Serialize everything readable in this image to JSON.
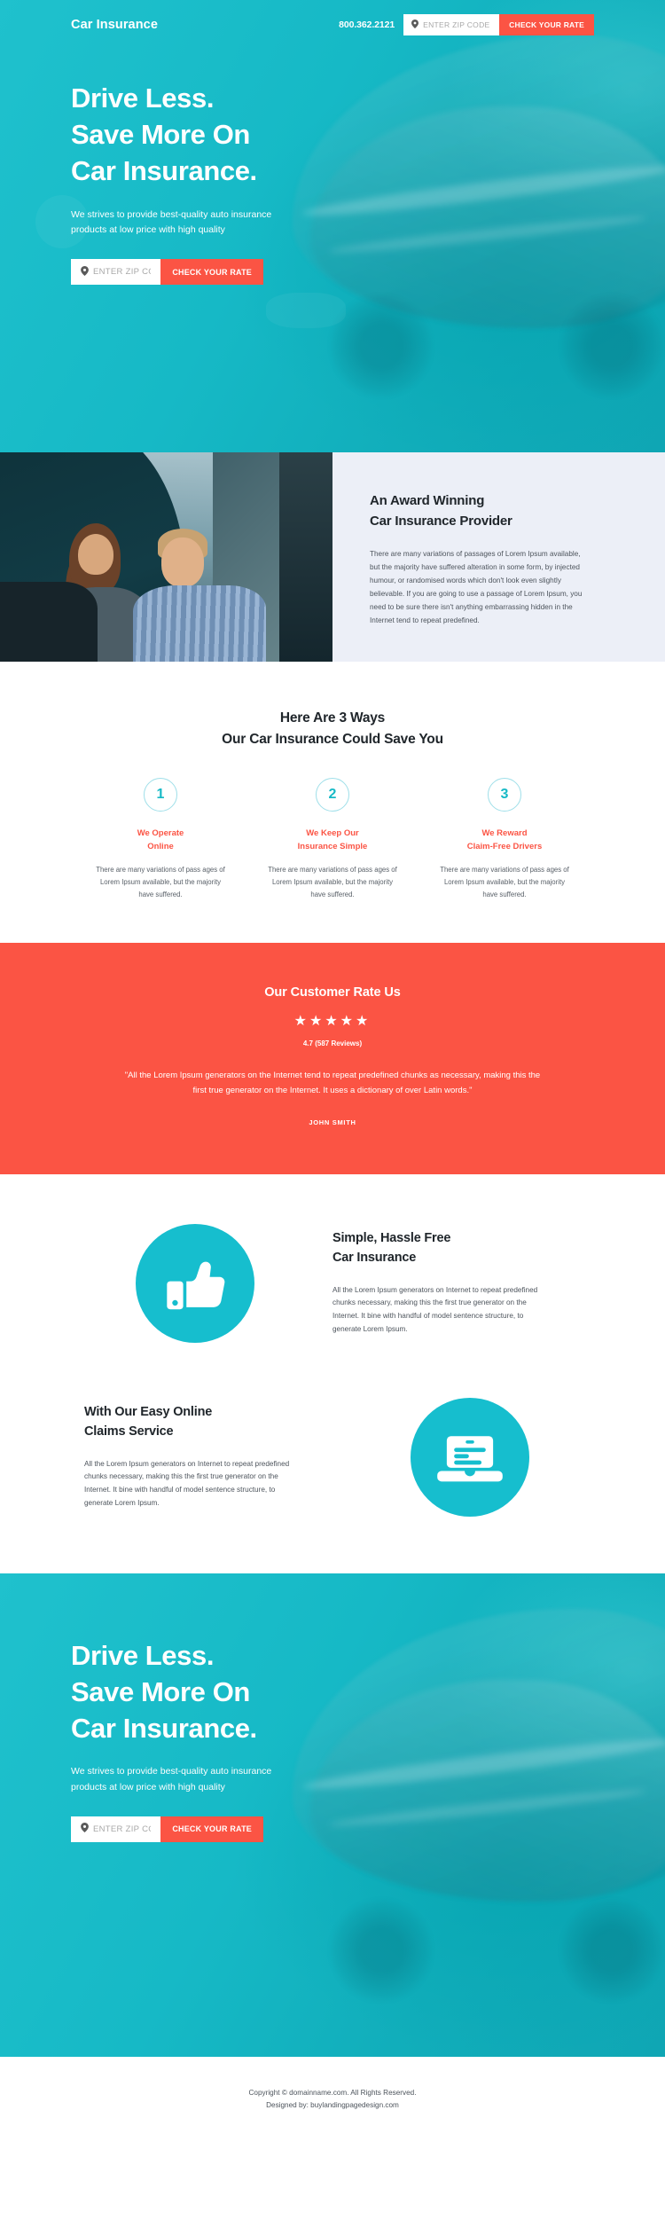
{
  "header": {
    "brand": "Car Insurance",
    "phone": "800.362.2121",
    "zip_placeholder": "ENTER ZIP CODE",
    "zip_value": "",
    "cta_label": "CHECK YOUR RATE",
    "pin_icon": "location-pin-icon"
  },
  "hero": {
    "title_line1": "Drive Less.",
    "title_line2": "Save More On",
    "title_line3": "Car Insurance.",
    "subtitle_line1": "We strives to provide best-quality auto insurance",
    "subtitle_line2": "products at low price with high quality",
    "zip_placeholder": "ENTER ZIP CODE",
    "zip_value": "",
    "cta_label": "CHECK YOUR RATE"
  },
  "award": {
    "title_line1": "An Award Winning",
    "title_line2": "Car Insurance Provider",
    "body": "There are many variations of passages of Lorem Ipsum available, but the majority have suffered alteration in some form, by injected humour, or randomised words which don't look even slightly believable. If you are going to use a passage of Lorem Ipsum, you need to be sure there isn't anything embarrassing hidden in the Internet tend to repeat predefined."
  },
  "ways": {
    "title_line1": "Here Are 3 Ways",
    "title_line2": "Our Car Insurance Could Save You",
    "items": [
      {
        "number": "1",
        "head_line1": "We Operate",
        "head_line2": "Online",
        "body": "There are many variations of pass ages of Lorem Ipsum available, but the majority have suffered."
      },
      {
        "number": "2",
        "head_line1": "We Keep Our",
        "head_line2": "Insurance Simple",
        "body": "There are many variations of pass ages of Lorem Ipsum available, but the majority have suffered."
      },
      {
        "number": "3",
        "head_line1": "We Reward",
        "head_line2": "Claim-Free Drivers",
        "body": "There are many variations of pass ages of Lorem Ipsum available, but the majority have suffered."
      }
    ]
  },
  "testimonial": {
    "title": "Our Customer Rate Us",
    "stars": "★★★★★",
    "star_count": 5,
    "score": "4.7 (587 Reviews)",
    "quote": "\"All the Lorem Ipsum generators on the Internet tend to repeat predefined chunks as necessary, making this the first true generator on the Internet. It uses a dictionary of over Latin words.\"",
    "author": "JOHN SMITH"
  },
  "features": [
    {
      "icon": "thumbs-up-icon",
      "title_line1": "Simple, Hassle Free",
      "title_line2": "Car Insurance",
      "body": "All the Lorem Ipsum generators on Internet to repeat predefined chunks necessary, making this the first true generator on the Internet. It bine with handful of model sentence structure, to generate Lorem Ipsum."
    },
    {
      "icon": "laptop-document-icon",
      "title_line1": "With Our Easy Online",
      "title_line2": "Claims Service",
      "body": "All the Lorem Ipsum generators on Internet to repeat predefined chunks necessary, making this the first true generator on the Internet. It bine with handful of model sentence structure, to generate Lorem Ipsum."
    }
  ],
  "footer": {
    "copyright": "Copyright © domainname.com. All Rights Reserved.",
    "designed_by": "Designed by: buylandingpagedesign.com"
  },
  "colors": {
    "teal": "#16bece",
    "teal_dark": "#0fa6b4",
    "accent_red": "#fb5444",
    "light_panel": "#eceff7",
    "heading": "#20262b"
  }
}
